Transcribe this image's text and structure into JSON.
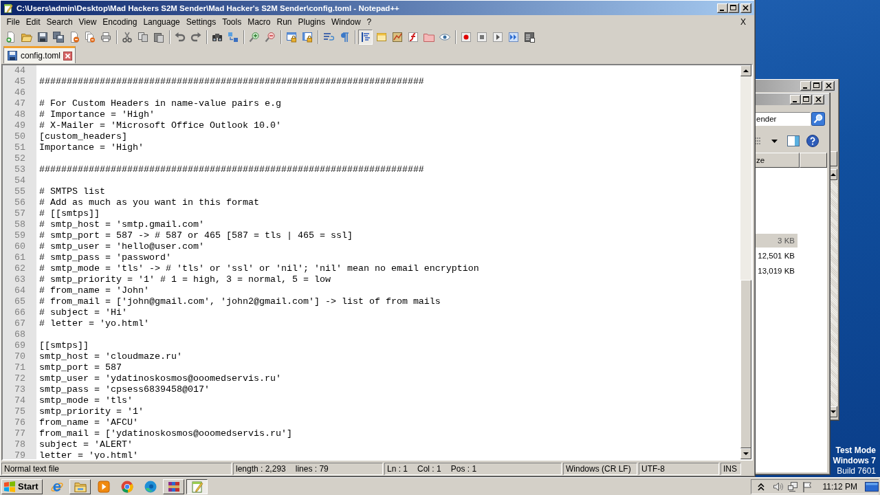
{
  "window": {
    "title": "C:\\Users\\admin\\Desktop\\Mad Hackers S2M Sender\\Mad Hacker's S2M Sender\\config.toml - Notepad++"
  },
  "menu": [
    "File",
    "Edit",
    "Search",
    "View",
    "Encoding",
    "Language",
    "Settings",
    "Tools",
    "Macro",
    "Run",
    "Plugins",
    "Window",
    "?"
  ],
  "menu_close": "X",
  "toolbar": [
    [
      {
        "pressed": false
      },
      {
        "pressed": false
      },
      {
        "pressed": false
      },
      {
        "pressed": false
      },
      {
        "pressed": false
      },
      {
        "pressed": false
      },
      {
        "pressed": false
      }
    ],
    [
      {
        "pressed": false
      },
      {
        "pressed": false
      },
      {
        "pressed": false
      }
    ],
    [
      {
        "pressed": false
      },
      {
        "pressed": false
      }
    ],
    [
      {
        "pressed": false
      },
      {
        "pressed": false
      }
    ],
    [
      {
        "pressed": false
      },
      {
        "pressed": false
      }
    ],
    [
      {
        "pressed": false
      },
      {
        "pressed": false
      }
    ],
    [
      {
        "pressed": false
      },
      {
        "pressed": false
      }
    ],
    [
      {
        "pressed": true
      },
      {
        "pressed": false
      },
      {
        "pressed": false
      },
      {
        "pressed": false
      },
      {
        "pressed": false
      },
      {
        "pressed": false
      }
    ],
    [
      {
        "pressed": false
      },
      {
        "pressed": false
      },
      {
        "pressed": false
      },
      {
        "pressed": false
      },
      {
        "pressed": false
      }
    ]
  ],
  "tabs": [
    {
      "label": "config.toml",
      "selected": true
    }
  ],
  "editor": {
    "lines": [
      {
        "number": "44"
      },
      {
        "number": "45",
        "text": "######################################################################"
      },
      {
        "number": "46"
      },
      {
        "number": "47",
        "text": "# For Custom Headers in name-value pairs e.g"
      },
      {
        "number": "48",
        "text": "# Importance = 'High'"
      },
      {
        "number": "49",
        "text": "# X-Mailer = 'Microsoft Office Outlook 10.0'"
      },
      {
        "number": "50",
        "text": "[custom_headers]"
      },
      {
        "number": "51",
        "text": "Importance = 'High'"
      },
      {
        "number": "52"
      },
      {
        "number": "53",
        "text": "######################################################################"
      },
      {
        "number": "54"
      },
      {
        "number": "55",
        "text": "# SMTPS list"
      },
      {
        "number": "56",
        "text": "# Add as much as you want in this format"
      },
      {
        "number": "57",
        "text": "# [[smtps]]"
      },
      {
        "number": "58",
        "text": "# smtp_host = 'smtp.gmail.com'"
      },
      {
        "number": "59",
        "text": "# smtp_port = 587 -> # 587 or 465 [587 = tls | 465 = ssl]"
      },
      {
        "number": "60",
        "text": "# smtp_user = 'hello@user.com'"
      },
      {
        "number": "61",
        "text": "# smtp_pass = 'password'"
      },
      {
        "number": "62",
        "text": "# smtp_mode = 'tls' -> # 'tls' or 'ssl' or 'nil'; 'nil' mean no email encryption"
      },
      {
        "number": "63",
        "text": "# smtp_priority = '1' # 1 = high, 3 = normal, 5 = low"
      },
      {
        "number": "64",
        "text": "# from_name = 'John'"
      },
      {
        "number": "65",
        "text": "# from_mail = ['john@gmail.com', 'john2@gmail.com'] -> list of from mails"
      },
      {
        "number": "66",
        "text": "# subject = 'Hi'"
      },
      {
        "number": "67",
        "text": "# letter = 'yo.html'"
      },
      {
        "number": "68"
      },
      {
        "number": "69",
        "text": "[[smtps]]"
      },
      {
        "number": "70",
        "text": "smtp_host = 'cloudmaze.ru'"
      },
      {
        "number": "71",
        "text": "smtp_port = 587"
      },
      {
        "number": "72",
        "text": "smtp_user = 'ydatinoskosmos@ooomedservis.ru'"
      },
      {
        "number": "73",
        "text": "smtp_pass = 'cpsess6839458@017'"
      },
      {
        "number": "74",
        "text": "smtp_mode = 'tls'"
      },
      {
        "number": "75",
        "text": "smtp_priority = '1'"
      },
      {
        "number": "76",
        "text": "from_name = 'AFCU'"
      },
      {
        "number": "77",
        "text": "from_mail = ['ydatinoskosmos@ooomedservis.ru']"
      },
      {
        "number": "78",
        "text": "subject = 'ALERT'"
      },
      {
        "number": "79",
        "text": "letter = 'yo.html'"
      }
    ]
  },
  "status_bar": {
    "file_type": "Normal text file",
    "length": "length : 2,293",
    "lines": "lines : 79",
    "line": "Ln : 1",
    "column": "Col : 1",
    "position": "Pos : 1",
    "eol": "Windows (CR LF)",
    "encoding": "UTF-8",
    "mode": "INS"
  },
  "explorer": {
    "search": "ender",
    "column_header": "ze",
    "sizes": [
      {
        "text": "3 KB",
        "selected": true
      },
      {
        "text": "12,501 KB",
        "selected": false
      },
      {
        "text": "13,019 KB",
        "selected": false
      }
    ]
  },
  "desktop": {
    "notice": [
      "Test Mode",
      "Windows 7",
      "Build 7601"
    ]
  },
  "taskbar": {
    "start": "Start",
    "apps": [
      {
        "running": false,
        "selected": false
      },
      {
        "running": true,
        "selected": false
      },
      {
        "running": false,
        "selected": false
      },
      {
        "running": false,
        "selected": false
      },
      {
        "running": false,
        "selected": false
      },
      {
        "running": true,
        "selected": false
      },
      {
        "running": true,
        "selected": true
      }
    ],
    "clock": "11:12 PM"
  }
}
